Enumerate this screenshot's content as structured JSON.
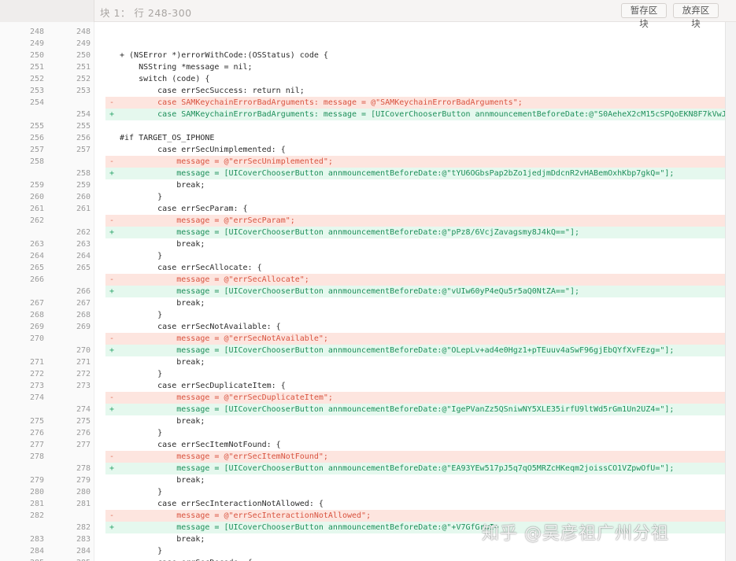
{
  "hunk": {
    "title": "块 1： 行 248-300",
    "stash_label": "暂存区块",
    "discard_label": "放弃区块"
  },
  "watermark": "知乎 @吴彦祖广州分祖",
  "lines": [
    {
      "old": "248",
      "new": "248",
      "type": "ctx",
      "text": ""
    },
    {
      "old": "249",
      "new": "249",
      "type": "ctx",
      "text": ""
    },
    {
      "old": "250",
      "new": "250",
      "type": "ctx",
      "text": "+ (NSError *)errorWithCode:(OSStatus) code {"
    },
    {
      "old": "251",
      "new": "251",
      "type": "ctx",
      "text": "    NSString *message = nil;"
    },
    {
      "old": "252",
      "new": "252",
      "type": "ctx",
      "text": "    switch (code) {"
    },
    {
      "old": "253",
      "new": "253",
      "type": "ctx",
      "text": "        case errSecSuccess: return nil;"
    },
    {
      "old": "254",
      "new": "",
      "type": "del",
      "text": "        case SAMKeychainErrorBadArguments: message = @\"SAMKeychainErrorBadArguments\";"
    },
    {
      "old": "",
      "new": "254",
      "type": "add",
      "text": "        case SAMKeychainErrorBadArguments: message = [UICoverChooserButton annmouncementBeforeDate:@\"S0AeheX2cM15cSPQoEKN8F7kVwJ"
    },
    {
      "old": "255",
      "new": "255",
      "type": "ctx",
      "text": ""
    },
    {
      "old": "256",
      "new": "256",
      "type": "ctx",
      "text": "#if TARGET_OS_IPHONE"
    },
    {
      "old": "257",
      "new": "257",
      "type": "ctx",
      "text": "        case errSecUnimplemented: {"
    },
    {
      "old": "258",
      "new": "",
      "type": "del",
      "text": "            message = @\"errSecUnimplemented\";"
    },
    {
      "old": "",
      "new": "258",
      "type": "add",
      "text": "            message = [UICoverChooserButton annmouncementBeforeDate:@\"tYU6OGbsPap2bZo1jedjmDdcnR2vHABemOxhKbp7gkQ=\"];"
    },
    {
      "old": "259",
      "new": "259",
      "type": "ctx",
      "text": "            break;"
    },
    {
      "old": "260",
      "new": "260",
      "type": "ctx",
      "text": "        }"
    },
    {
      "old": "261",
      "new": "261",
      "type": "ctx",
      "text": "        case errSecParam: {"
    },
    {
      "old": "262",
      "new": "",
      "type": "del",
      "text": "            message = @\"errSecParam\";"
    },
    {
      "old": "",
      "new": "262",
      "type": "add",
      "text": "            message = [UICoverChooserButton annmouncementBeforeDate:@\"pPz8/6VcjZavagsmy8J4kQ==\"];"
    },
    {
      "old": "263",
      "new": "263",
      "type": "ctx",
      "text": "            break;"
    },
    {
      "old": "264",
      "new": "264",
      "type": "ctx",
      "text": "        }"
    },
    {
      "old": "265",
      "new": "265",
      "type": "ctx",
      "text": "        case errSecAllocate: {"
    },
    {
      "old": "266",
      "new": "",
      "type": "del",
      "text": "            message = @\"errSecAllocate\";"
    },
    {
      "old": "",
      "new": "266",
      "type": "add",
      "text": "            message = [UICoverChooserButton annmouncementBeforeDate:@\"vUIw60yP4eQu5r5aQ0NtZA==\"];"
    },
    {
      "old": "267",
      "new": "267",
      "type": "ctx",
      "text": "            break;"
    },
    {
      "old": "268",
      "new": "268",
      "type": "ctx",
      "text": "        }"
    },
    {
      "old": "269",
      "new": "269",
      "type": "ctx",
      "text": "        case errSecNotAvailable: {"
    },
    {
      "old": "270",
      "new": "",
      "type": "del",
      "text": "            message = @\"errSecNotAvailable\";"
    },
    {
      "old": "",
      "new": "270",
      "type": "add",
      "text": "            message = [UICoverChooserButton annmouncementBeforeDate:@\"OLepLv+ad4e0Hgz1+pTEuuv4aSwF96gjEbQYfXvFEzg=\"];"
    },
    {
      "old": "271",
      "new": "271",
      "type": "ctx",
      "text": "            break;"
    },
    {
      "old": "272",
      "new": "272",
      "type": "ctx",
      "text": "        }"
    },
    {
      "old": "273",
      "new": "273",
      "type": "ctx",
      "text": "        case errSecDuplicateItem: {"
    },
    {
      "old": "274",
      "new": "",
      "type": "del",
      "text": "            message = @\"errSecDuplicateItem\";"
    },
    {
      "old": "",
      "new": "274",
      "type": "add",
      "text": "            message = [UICoverChooserButton annmouncementBeforeDate:@\"IgePVanZz5QSniwNY5XLE35irfU9ltWd5rGm1Un2UZ4=\"];"
    },
    {
      "old": "275",
      "new": "275",
      "type": "ctx",
      "text": "            break;"
    },
    {
      "old": "276",
      "new": "276",
      "type": "ctx",
      "text": "        }"
    },
    {
      "old": "277",
      "new": "277",
      "type": "ctx",
      "text": "        case errSecItemNotFound: {"
    },
    {
      "old": "278",
      "new": "",
      "type": "del",
      "text": "            message = @\"errSecItemNotFound\";"
    },
    {
      "old": "",
      "new": "278",
      "type": "add",
      "text": "            message = [UICoverChooserButton annmouncementBeforeDate:@\"EA93YEw517pJ5q7qO5MRZcHKeqm2joissCO1VZpwOfU=\"];"
    },
    {
      "old": "279",
      "new": "279",
      "type": "ctx",
      "text": "            break;"
    },
    {
      "old": "280",
      "new": "280",
      "type": "ctx",
      "text": "        }"
    },
    {
      "old": "281",
      "new": "281",
      "type": "ctx",
      "text": "        case errSecInteractionNotAllowed: {"
    },
    {
      "old": "282",
      "new": "",
      "type": "del",
      "text": "            message = @\"errSecInteractionNotAllowed\";"
    },
    {
      "old": "",
      "new": "282",
      "type": "add",
      "text": "            message = [UICoverChooserButton annmouncementBeforeDate:@\"+V7GfGrwI+"
    },
    {
      "old": "283",
      "new": "283",
      "type": "ctx",
      "text": "            break;"
    },
    {
      "old": "284",
      "new": "284",
      "type": "ctx",
      "text": "        }"
    },
    {
      "old": "285",
      "new": "285",
      "type": "ctx",
      "text": "        case errSecDecode: {"
    }
  ]
}
